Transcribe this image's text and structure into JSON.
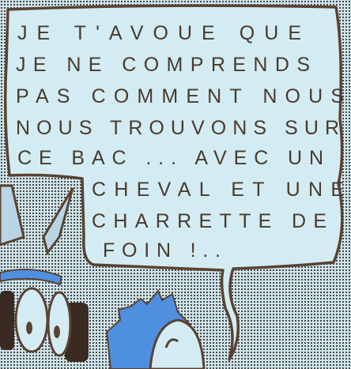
{
  "speech_bubble": {
    "lines": [
      "JE T'AVOUE QUE",
      "JE NE COMPRENDS",
      "PAS COMMENT NOUS",
      "NOUS TROUVONS SUR",
      "CE BAC ... AVEC UN",
      "CHEVAL ET UNE",
      "CHARRETTE DE",
      "FOIN !.."
    ]
  },
  "colors": {
    "bubble_fill": "#d3ecf3",
    "outline": "#5a4232",
    "character_blue": "#4f8fe0",
    "background": "#cfe6ee"
  }
}
